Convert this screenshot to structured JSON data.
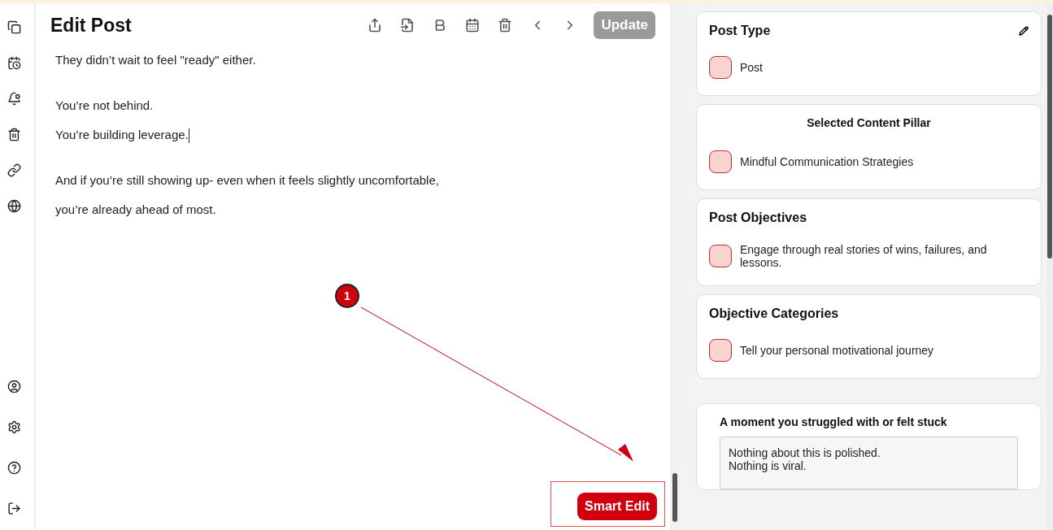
{
  "sidebar": {
    "top_items": [
      {
        "kind": "pages"
      },
      {
        "kind": "schedule"
      },
      {
        "kind": "notifications"
      },
      {
        "kind": "trash"
      },
      {
        "kind": "link"
      },
      {
        "kind": "globe"
      }
    ],
    "bottom_items": [
      {
        "kind": "profile"
      },
      {
        "kind": "settings"
      },
      {
        "kind": "help"
      },
      {
        "kind": "logout"
      }
    ]
  },
  "editor": {
    "title": "Edit Post",
    "toolbar": [
      {
        "kind": "share"
      },
      {
        "kind": "import"
      },
      {
        "kind": "bold"
      },
      {
        "kind": "calendar"
      },
      {
        "kind": "delete"
      },
      {
        "kind": "previous"
      },
      {
        "kind": "next"
      }
    ],
    "update_button": {
      "label": "Update",
      "disabled": true
    },
    "paragraphs": [
      {
        "lines": [
          {
            "text": "They didn’t wait to feel \"ready\" either.",
            "caret": false
          }
        ]
      },
      {
        "lines": [
          {
            "text": "You’re not behind.",
            "caret": false
          },
          {
            "text": "You’re building leverage.",
            "caret": true
          }
        ]
      },
      {
        "lines": [
          {
            "text": "And if you’re still showing up- even when it feels slightly uncomfortable,",
            "caret": false
          },
          {
            "text": "you’re already ahead of most.",
            "caret": false
          }
        ]
      }
    ],
    "smart_edit_button": {
      "label": "Smart Edit"
    },
    "annotation": {
      "number": "1"
    }
  },
  "panel": {
    "cards": [
      {
        "kind": "section",
        "title": "Post Type",
        "editable": true,
        "title_centered": false,
        "items": [
          {
            "text": "Post"
          }
        ]
      },
      {
        "kind": "section",
        "title": "Selected Content Pillar",
        "editable": false,
        "title_centered": true,
        "items": [
          {
            "text": "Mindful Communication Strategies"
          }
        ]
      },
      {
        "kind": "section",
        "title": "Post Objectives",
        "editable": false,
        "title_centered": false,
        "items": [
          {
            "text": "Engage through real stories of wins, failures, and lessons."
          }
        ]
      },
      {
        "kind": "section",
        "title": "Objective Categories",
        "editable": false,
        "title_centered": false,
        "items": [
          {
            "text": "Tell your personal motivational journey"
          }
        ]
      },
      {
        "kind": "field",
        "title": "A moment you struggled with or felt stuck",
        "value": "Nothing about this is polished.\nNothing is viral."
      }
    ]
  }
}
